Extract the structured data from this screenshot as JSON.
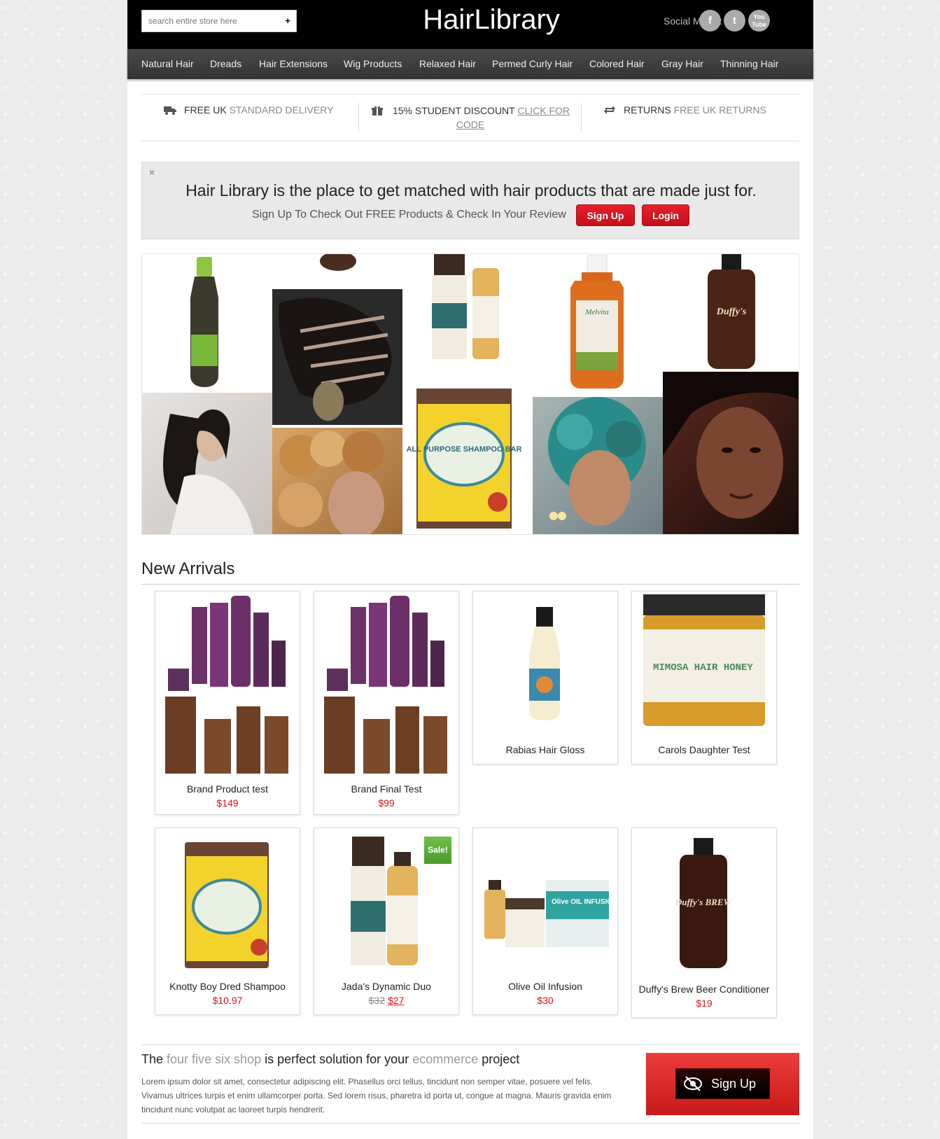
{
  "header": {
    "search_placeholder": "search entire store here",
    "search_button": "+",
    "logo": "HairLibrary",
    "social_label": "Social Media:",
    "social": [
      {
        "name": "facebook",
        "glyph": "f"
      },
      {
        "name": "twitter",
        "glyph": "t"
      },
      {
        "name": "youtube",
        "glyph": "You Tube"
      }
    ]
  },
  "nav": [
    "Natural Hair",
    "Dreads",
    "Hair Extensions",
    "Wig Products",
    "Relaxed Hair",
    "Permed Curly Hair",
    "Colored Hair",
    "Gray Hair",
    "Thinning Hair"
  ],
  "infobar": {
    "delivery_strong": "FREE UK",
    "delivery_muted": "STANDARD DELIVERY",
    "discount_strong": "15% STUDENT DISCOUNT",
    "discount_link_1": "CLICK FOR",
    "discount_link_2": "CODE",
    "returns_strong": "RETURNS",
    "returns_muted": "FREE UK RETURNS"
  },
  "promo": {
    "close": "×",
    "headline": "Hair Library is the place to get matched with hair products that are made just for.",
    "sub": "Sign Up To Check Out FREE Products & Check In Your Review",
    "signup": "Sign Up",
    "login": "Login"
  },
  "collage_text": {
    "shampoo_bar": "ALL PURPOSE SHAMPOO BAR",
    "duffys": "Duffy's",
    "melvita": "Melvita"
  },
  "new_arrivals": {
    "title": "New Arrivals",
    "products": [
      {
        "name": "Brand Product test",
        "price": "$149"
      },
      {
        "name": "Brand Final Test",
        "price": "$99"
      },
      {
        "name": "Rabias Hair Gloss",
        "price": ""
      },
      {
        "name": "Carols Daughter Test",
        "price": ""
      },
      {
        "name": "Knotty Boy Dred Shampoo",
        "price": "$10.97"
      },
      {
        "name": "Jada's Dynamic Duo",
        "old_price": "$32",
        "price": "$27",
        "badge": "Sale!"
      },
      {
        "name": "Olive Oil Infusion",
        "price": "$30"
      },
      {
        "name": "Duffy's Brew Beer Conditioner",
        "price": "$19"
      }
    ],
    "label_text": {
      "mimosa": "MIMOSA HAIR HONEY",
      "olive": "Olive OIL INFUSION",
      "duffys_brew": "Duffy's BREW"
    }
  },
  "footer": {
    "head_1": "The ",
    "head_hl_1": "four five six shop",
    "head_2": " is perfect solution for your ",
    "head_hl_2": "ecommerce",
    "head_3": " project",
    "body": "Lorem ipsum dolor sit amet, consectetur adipiscing elit. Phasellus orci tellus, tincidunt non semper vitae, posuere vel felis. Vivamus ultrices turpis et enim ullamcorper porta. Sed lorem risus, pharetra id porta ut, congue at magna. Mauris gravida enim tincidunt nunc volutpat ac laoreet turpis hendrerit.",
    "cta": "Sign Up"
  },
  "colors": {
    "accent": "#e8202b",
    "price": "#e01010",
    "header_bg": "#000000",
    "nav_bg": "#3d3d3d",
    "sale": "#5cab36"
  }
}
